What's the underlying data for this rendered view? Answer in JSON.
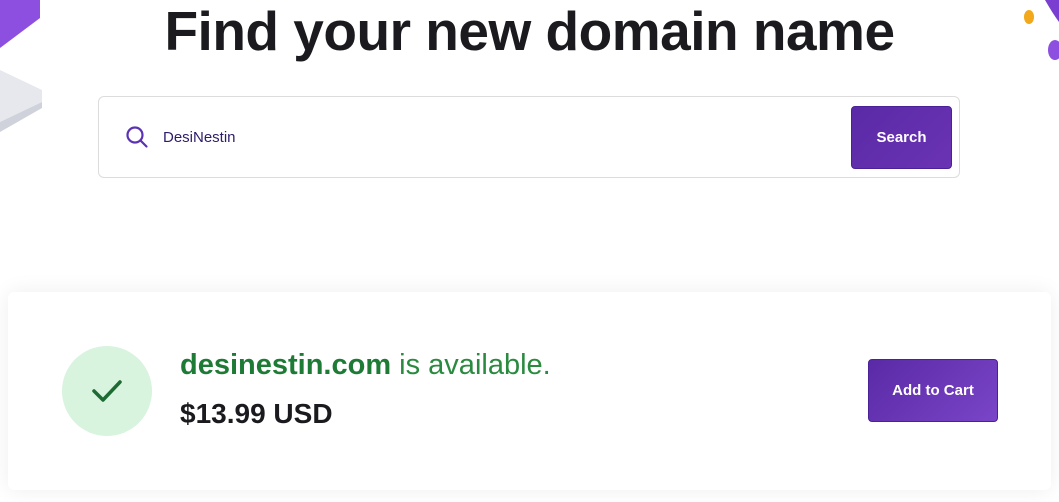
{
  "header": {
    "title": "Find your new domain name"
  },
  "search": {
    "value": "DesiNestin",
    "button_label": "Search",
    "icon": "search-icon"
  },
  "result": {
    "domain": "desinestin.com",
    "status": " is available.",
    "price": "$13.99 USD",
    "button_label": "Add to Cart",
    "icon": "check-icon"
  },
  "colors": {
    "accent_purple": "#5a2aa6",
    "success_green": "#1d7b35",
    "success_bg": "#d8f3de"
  }
}
